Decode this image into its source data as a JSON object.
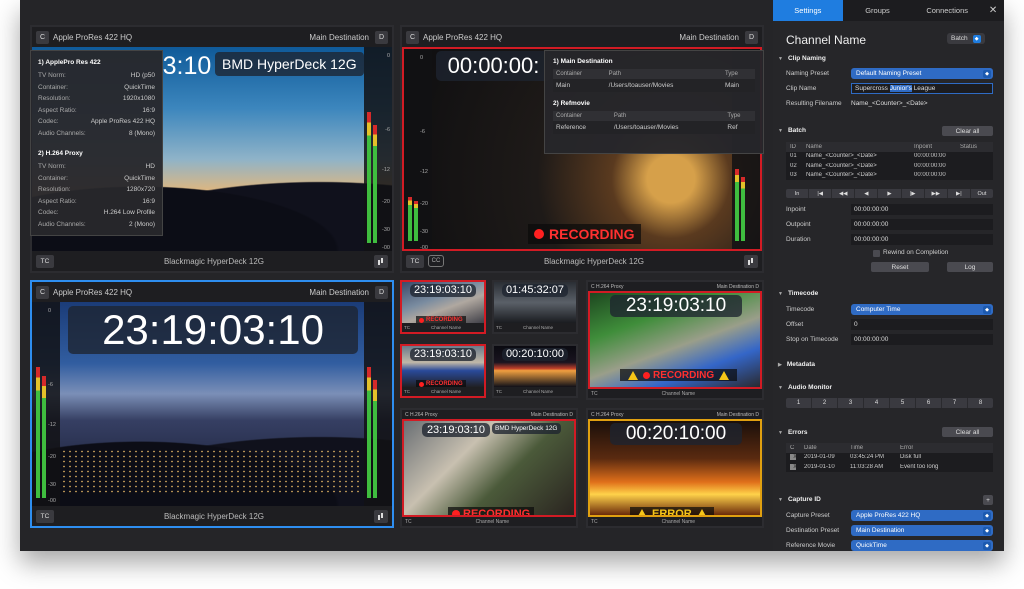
{
  "sidebar": {
    "tabs": [
      "Settings",
      "Groups",
      "Connections"
    ],
    "close": "✕",
    "channel_name": "Channel Name",
    "batch_button": "Batch",
    "clip_naming": {
      "heading": "Clip Naming",
      "naming_preset_label": "Naming Preset",
      "naming_preset_value": "Default Naming Preset",
      "clip_name_label": "Clip Name",
      "clip_name_before": "Supercross ",
      "clip_name_selected": "Junior's",
      "clip_name_after": " League",
      "resulting_filename_label": "Resulting Filename",
      "resulting_filename_value": "Name_<Counter>_<Date>"
    },
    "batch": {
      "heading": "Batch",
      "clear_all": "Clear all",
      "columns": [
        "ID",
        "Name",
        "Inpoint",
        "Status"
      ],
      "rows": [
        {
          "id": "01",
          "name": "Name_<Counter>_<Date>",
          "inpoint": "00:00:00:00",
          "status": ""
        },
        {
          "id": "02",
          "name": "Name_<Counter>_<Date>",
          "inpoint": "00:00:00:00",
          "status": ""
        },
        {
          "id": "03",
          "name": "Name_<Counter>_<Date>",
          "inpoint": "00:00:00:00",
          "status": ""
        }
      ],
      "transport": [
        "In",
        "|◀",
        "◀◀",
        "◀",
        "▶",
        "|▶",
        "▶▶",
        "▶|",
        "Out"
      ],
      "inpoint_label": "Inpoint",
      "inpoint_value": "00:00:00:00",
      "outpoint_label": "Outpoint",
      "outpoint_value": "00:00:00:00",
      "duration_label": "Duration",
      "duration_value": "00:00:00:00",
      "rewind_label": "Rewind on Completion",
      "reset": "Reset",
      "log": "Log"
    },
    "timecode": {
      "heading": "Timecode",
      "timecode_label": "Timecode",
      "timecode_value": "Computer Time",
      "offset_label": "Offset",
      "offset_value": "0",
      "stop_label": "Stop on Timecode",
      "stop_value": "00:00:00:00"
    },
    "metadata_heading": "Metadata",
    "audio_monitor": {
      "heading": "Audio Monitor",
      "channels": [
        "1",
        "2",
        "3",
        "4",
        "5",
        "6",
        "7",
        "8"
      ]
    },
    "errors": {
      "heading": "Errors",
      "clear_all": "Clear all",
      "columns": [
        "C",
        "Date",
        "Time",
        "Error"
      ],
      "rows": [
        {
          "c": "X",
          "date": "2019-01-09",
          "time": "03:45:24 PM",
          "error": "Disk full"
        },
        {
          "c": "X",
          "date": "2019-01-10",
          "time": "11:03:28 AM",
          "error": "Event too long"
        }
      ]
    },
    "capture_id": {
      "heading": "Capture ID",
      "add": "+",
      "capture_preset_label": "Capture Preset",
      "capture_preset_value": "Apple ProRes 422 HQ",
      "destination_preset_label": "Destination Preset",
      "destination_preset_value": "Main Destination",
      "reference_movie_label": "Reference Movie",
      "reference_movie_value": "QuickTime"
    }
  },
  "channels": {
    "tl": {
      "c": "C",
      "codec": "Apple ProRes 422 HQ",
      "dest": "Main Destination",
      "d": "D",
      "timecode": "3:10",
      "name": "BMD HyperDeck 12G",
      "source": "Blackmagic HyperDeck 12G",
      "tc": "TC"
    },
    "tr": {
      "c": "C",
      "codec": "Apple ProRes 422 HQ",
      "dest": "Main Destination",
      "d": "D",
      "timecode": "00:00:00:",
      "source": "Blackmagic HyperDeck 12G",
      "tc": "TC",
      "cc": "CC",
      "status": "RECORDING"
    },
    "bl": {
      "c": "C",
      "codec": "Apple ProRes 422 HQ",
      "dest": "Main Destination",
      "d": "D",
      "timecode": "23:19:03:10",
      "source": "Blackmagic HyperDeck 12G",
      "tc": "TC"
    }
  },
  "meter_labels": [
    "0",
    "-6",
    "-12",
    "-20",
    "-30",
    "-00"
  ],
  "minis": [
    {
      "timecode": "23:19:03:10",
      "label": "Channel Name",
      "tc": "TC",
      "status": "RECORDING"
    },
    {
      "timecode": "01:45:32:07",
      "label": "Channel Name",
      "tc": "TC"
    },
    {
      "timecode": "23:19:03:10",
      "label": "Channel Name",
      "tc": "TC",
      "status": "RECORDING"
    },
    {
      "timecode": "00:20:10:00",
      "label": "Channel Name",
      "tc": "TC"
    }
  ],
  "mids": {
    "road": {
      "codec": "C  H.264 Proxy",
      "dest": "Main Destination  D",
      "timecode": "23:19:03:10",
      "status": "RECORDING",
      "tc": "TC",
      "label": "Channel Name"
    },
    "street": {
      "codec": "C  H.264 Proxy",
      "dest": "Main Destination  D",
      "timecode": "23:19:03:10",
      "name": "BMD HyperDeck 12G",
      "status": "RECORDING",
      "tc": "TC",
      "label": "Channel Name"
    },
    "fire": {
      "codec": "C  H.264 Proxy",
      "dest": "Main Destination  D",
      "timecode": "00:20:10:00",
      "status": "ERROR",
      "tc": "TC",
      "label": "Channel Name"
    }
  },
  "info_popup": {
    "h1": "1) ApplePro Res 422",
    "rows1": [
      {
        "k": "TV Norm:",
        "v": "HD (p50"
      },
      {
        "k": "Container:",
        "v": "QuickTime"
      },
      {
        "k": "Resolution:",
        "v": "1920x1080"
      },
      {
        "k": "Aspect Ratio:",
        "v": "16:9"
      },
      {
        "k": "Codec:",
        "v": "Apple ProRes 422 HQ"
      },
      {
        "k": "Audio Channels:",
        "v": "8 (Mono)"
      }
    ],
    "h2": "2) H.264 Proxy",
    "rows2": [
      {
        "k": "TV Norm:",
        "v": "HD"
      },
      {
        "k": "Container:",
        "v": "QuickTime"
      },
      {
        "k": "Resolution:",
        "v": "1280x720"
      },
      {
        "k": "Aspect Ratio:",
        "v": "16:9"
      },
      {
        "k": "Codec:",
        "v": "H.264 Low Profile"
      },
      {
        "k": "Audio Channels:",
        "v": "2 (Mono)"
      }
    ]
  },
  "dest_popup": {
    "h1": "1) Main Destination",
    "h2": "2) Refmovie",
    "columns": [
      "Container",
      "Path",
      "Type"
    ],
    "row1": {
      "container": "Main",
      "path": "/Users/toauser/Movies",
      "type": "Main"
    },
    "row2": {
      "container": "Reference",
      "path": "/Users/toauser/Movies",
      "type": "Ref"
    }
  },
  "colors": {
    "accent": "#1f7de0",
    "record": "#d21b24",
    "error": "#f5c518"
  }
}
